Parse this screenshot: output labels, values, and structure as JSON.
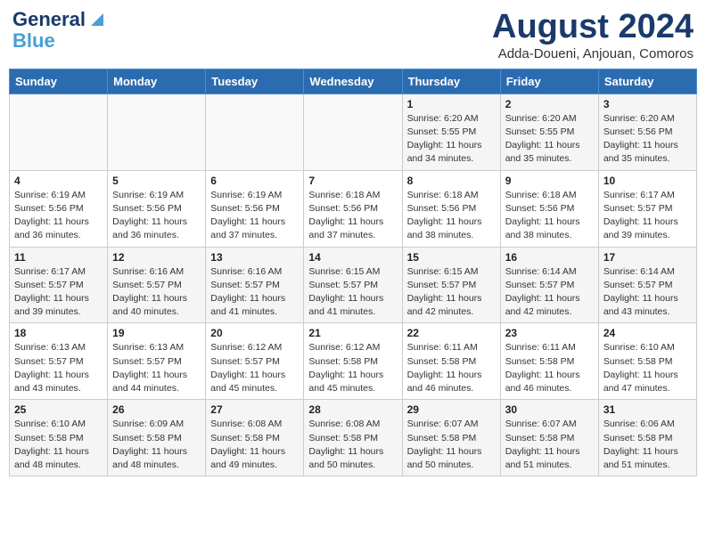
{
  "header": {
    "logo_line1": "General",
    "logo_line2": "Blue",
    "month_title": "August 2024",
    "location": "Adda-Doueni, Anjouan, Comoros"
  },
  "days_of_week": [
    "Sunday",
    "Monday",
    "Tuesday",
    "Wednesday",
    "Thursday",
    "Friday",
    "Saturday"
  ],
  "weeks": [
    [
      {
        "day": "",
        "sunrise": "",
        "sunset": "",
        "daylight": ""
      },
      {
        "day": "",
        "sunrise": "",
        "sunset": "",
        "daylight": ""
      },
      {
        "day": "",
        "sunrise": "",
        "sunset": "",
        "daylight": ""
      },
      {
        "day": "",
        "sunrise": "",
        "sunset": "",
        "daylight": ""
      },
      {
        "day": "1",
        "sunrise": "6:20 AM",
        "sunset": "5:55 PM",
        "daylight": "11 hours and 34 minutes."
      },
      {
        "day": "2",
        "sunrise": "6:20 AM",
        "sunset": "5:55 PM",
        "daylight": "11 hours and 35 minutes."
      },
      {
        "day": "3",
        "sunrise": "6:20 AM",
        "sunset": "5:56 PM",
        "daylight": "11 hours and 35 minutes."
      }
    ],
    [
      {
        "day": "4",
        "sunrise": "6:19 AM",
        "sunset": "5:56 PM",
        "daylight": "11 hours and 36 minutes."
      },
      {
        "day": "5",
        "sunrise": "6:19 AM",
        "sunset": "5:56 PM",
        "daylight": "11 hours and 36 minutes."
      },
      {
        "day": "6",
        "sunrise": "6:19 AM",
        "sunset": "5:56 PM",
        "daylight": "11 hours and 37 minutes."
      },
      {
        "day": "7",
        "sunrise": "6:18 AM",
        "sunset": "5:56 PM",
        "daylight": "11 hours and 37 minutes."
      },
      {
        "day": "8",
        "sunrise": "6:18 AM",
        "sunset": "5:56 PM",
        "daylight": "11 hours and 38 minutes."
      },
      {
        "day": "9",
        "sunrise": "6:18 AM",
        "sunset": "5:56 PM",
        "daylight": "11 hours and 38 minutes."
      },
      {
        "day": "10",
        "sunrise": "6:17 AM",
        "sunset": "5:57 PM",
        "daylight": "11 hours and 39 minutes."
      }
    ],
    [
      {
        "day": "11",
        "sunrise": "6:17 AM",
        "sunset": "5:57 PM",
        "daylight": "11 hours and 39 minutes."
      },
      {
        "day": "12",
        "sunrise": "6:16 AM",
        "sunset": "5:57 PM",
        "daylight": "11 hours and 40 minutes."
      },
      {
        "day": "13",
        "sunrise": "6:16 AM",
        "sunset": "5:57 PM",
        "daylight": "11 hours and 41 minutes."
      },
      {
        "day": "14",
        "sunrise": "6:15 AM",
        "sunset": "5:57 PM",
        "daylight": "11 hours and 41 minutes."
      },
      {
        "day": "15",
        "sunrise": "6:15 AM",
        "sunset": "5:57 PM",
        "daylight": "11 hours and 42 minutes."
      },
      {
        "day": "16",
        "sunrise": "6:14 AM",
        "sunset": "5:57 PM",
        "daylight": "11 hours and 42 minutes."
      },
      {
        "day": "17",
        "sunrise": "6:14 AM",
        "sunset": "5:57 PM",
        "daylight": "11 hours and 43 minutes."
      }
    ],
    [
      {
        "day": "18",
        "sunrise": "6:13 AM",
        "sunset": "5:57 PM",
        "daylight": "11 hours and 43 minutes."
      },
      {
        "day": "19",
        "sunrise": "6:13 AM",
        "sunset": "5:57 PM",
        "daylight": "11 hours and 44 minutes."
      },
      {
        "day": "20",
        "sunrise": "6:12 AM",
        "sunset": "5:57 PM",
        "daylight": "11 hours and 45 minutes."
      },
      {
        "day": "21",
        "sunrise": "6:12 AM",
        "sunset": "5:58 PM",
        "daylight": "11 hours and 45 minutes."
      },
      {
        "day": "22",
        "sunrise": "6:11 AM",
        "sunset": "5:58 PM",
        "daylight": "11 hours and 46 minutes."
      },
      {
        "day": "23",
        "sunrise": "6:11 AM",
        "sunset": "5:58 PM",
        "daylight": "11 hours and 46 minutes."
      },
      {
        "day": "24",
        "sunrise": "6:10 AM",
        "sunset": "5:58 PM",
        "daylight": "11 hours and 47 minutes."
      }
    ],
    [
      {
        "day": "25",
        "sunrise": "6:10 AM",
        "sunset": "5:58 PM",
        "daylight": "11 hours and 48 minutes."
      },
      {
        "day": "26",
        "sunrise": "6:09 AM",
        "sunset": "5:58 PM",
        "daylight": "11 hours and 48 minutes."
      },
      {
        "day": "27",
        "sunrise": "6:08 AM",
        "sunset": "5:58 PM",
        "daylight": "11 hours and 49 minutes."
      },
      {
        "day": "28",
        "sunrise": "6:08 AM",
        "sunset": "5:58 PM",
        "daylight": "11 hours and 50 minutes."
      },
      {
        "day": "29",
        "sunrise": "6:07 AM",
        "sunset": "5:58 PM",
        "daylight": "11 hours and 50 minutes."
      },
      {
        "day": "30",
        "sunrise": "6:07 AM",
        "sunset": "5:58 PM",
        "daylight": "11 hours and 51 minutes."
      },
      {
        "day": "31",
        "sunrise": "6:06 AM",
        "sunset": "5:58 PM",
        "daylight": "11 hours and 51 minutes."
      }
    ]
  ]
}
